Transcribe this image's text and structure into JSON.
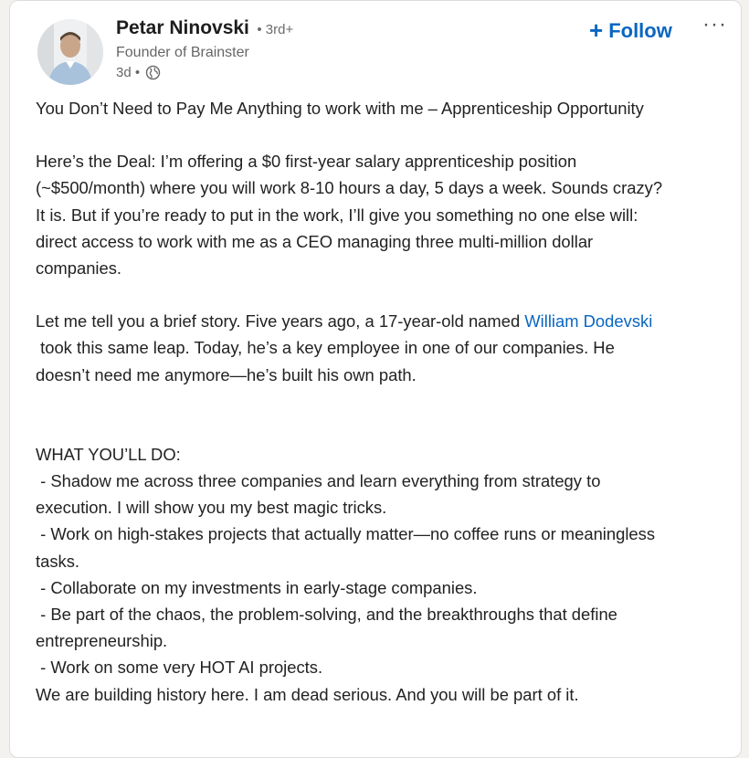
{
  "author": {
    "name": "Petar Ninovski",
    "degree": "• 3rd+",
    "headline": "Founder of Brainster",
    "time": "3d •",
    "visibility_icon": "globe-icon"
  },
  "actions": {
    "follow_label": "Follow",
    "follow_icon": "+",
    "more_label": "···"
  },
  "colors": {
    "accent": "#0a66c2",
    "text": "#222222",
    "muted": "#666666"
  },
  "post": {
    "title_line": "You Don’t Need to Pay Me Anything to work with me – Apprenticeship Opportunity",
    "deal_lines": [
      "Here’s the Deal: I’m offering a $0 first-year salary apprenticeship position",
      "(~$500/month) where you will work 8-10 hours a day, 5 days a week. Sounds crazy?",
      "It is. But if you’re ready to put in the work, I’ll give you something no one else will:",
      "direct access to work with me as a CEO managing three multi-million dollar",
      "companies."
    ],
    "story_before": "Let me tell you a brief story. Five years ago, a 17-year-old named ",
    "story_mention": "William Dodevski",
    "story_lines": [
      " took this same leap. Today, he’s a key employee in one of our companies. He",
      "doesn’t need me anymore—he’s built his own path."
    ],
    "section_heading": "WHAT YOU’LL DO:",
    "bullet_lines": [
      " - Shadow me across three companies and learn everything from strategy to",
      "execution. I will show you my best magic tricks.",
      " - Work on high-stakes projects that actually matter—no coffee runs or meaningless",
      "tasks.",
      " - Collaborate on my investments in early-stage companies.",
      " - Be part of the chaos, the problem-solving, and the breakthroughs that define",
      "entrepreneurship.",
      " - Work on some very HOT AI projects."
    ],
    "closing": "We are building history here. I am dead serious. And you will be part of it."
  }
}
